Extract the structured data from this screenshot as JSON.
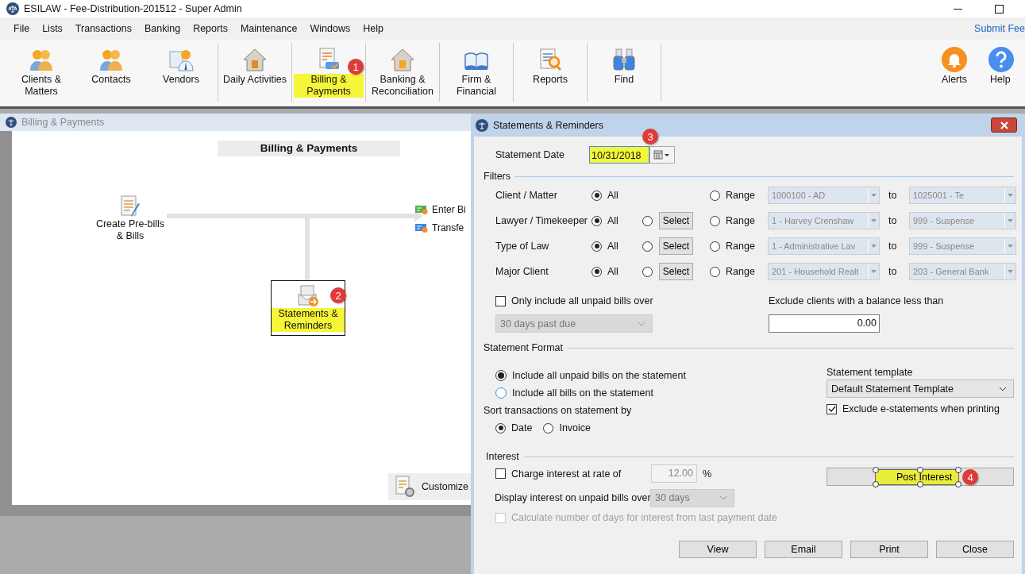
{
  "window": {
    "title": "ESILAW - Fee-Distribution-201512 - Super Admin"
  },
  "menu": [
    "File",
    "Lists",
    "Transactions",
    "Banking",
    "Reports",
    "Maintenance",
    "Windows",
    "Help"
  ],
  "feedback_link": "Submit Fee",
  "toolbar": {
    "groups": [
      [
        {
          "label": "Clients & Matters",
          "highlighted": false
        },
        {
          "label": "Contacts",
          "highlighted": false
        },
        {
          "label": "Vendors",
          "highlighted": false
        }
      ],
      [
        {
          "label": "Daily Activities",
          "highlighted": false
        }
      ],
      [
        {
          "label": "Billing & Payments",
          "highlighted": true,
          "badge": "1"
        }
      ],
      [
        {
          "label": "Banking & Reconciliation",
          "highlighted": false
        }
      ],
      [
        {
          "label": "Firm & Financial",
          "highlighted": false
        }
      ],
      [
        {
          "label": "Reports",
          "highlighted": false
        }
      ],
      [
        {
          "label": "Find",
          "highlighted": false
        }
      ]
    ],
    "right": [
      {
        "label": "Alerts"
      },
      {
        "label": "Help"
      }
    ]
  },
  "child_window": {
    "title": "Billing & Payments",
    "heading": "Billing & Payments",
    "nodes": [
      {
        "label": "Create Pre-bills & Bills",
        "selected": false,
        "highlighted": false
      },
      {
        "label": "Statements & Reminders",
        "selected": true,
        "highlighted": true,
        "badge": "2"
      }
    ],
    "links": [
      "Enter Bi",
      "Transfe"
    ],
    "customize": "Customize"
  },
  "dialog": {
    "title": "Statements & Reminders",
    "statement_date": {
      "label": "Statement Date",
      "value": "10/31/2018",
      "highlighted": true,
      "badge": "3"
    },
    "filters": {
      "title": "Filters",
      "rows": [
        {
          "label": "Client / Matter",
          "options": [
            {
              "kind": "radio",
              "label": "All",
              "selected": true
            },
            {
              "kind": "radio",
              "label": "Range",
              "selected": false
            }
          ],
          "from": {
            "value": "1000100 - AD",
            "disabled": true
          },
          "to_label": "to",
          "to": {
            "value": "1025001 - Te",
            "disabled": true
          }
        },
        {
          "label": "Lawyer / Timekeeper",
          "options": [
            {
              "kind": "radio",
              "label": "All",
              "selected": true
            },
            {
              "kind": "select",
              "label": "Select",
              "selected": false
            },
            {
              "kind": "radio",
              "label": "Range",
              "selected": false
            }
          ],
          "from": {
            "value": "1 - Harvey Crenshaw",
            "disabled": true
          },
          "to_label": "to",
          "to": {
            "value": "999 - Suspense",
            "disabled": true
          }
        },
        {
          "label": "Type of Law",
          "options": [
            {
              "kind": "radio",
              "label": "All",
              "selected": true
            },
            {
              "kind": "select",
              "label": "Select",
              "selected": false
            },
            {
              "kind": "radio",
              "label": "Range",
              "selected": false
            }
          ],
          "from": {
            "value": "1 - Administrative Lav",
            "disabled": true
          },
          "to_label": "to",
          "to": {
            "value": "999 - Suspense",
            "disabled": true
          }
        },
        {
          "label": "Major Client",
          "options": [
            {
              "kind": "radio",
              "label": "All",
              "selected": true
            },
            {
              "kind": "select",
              "label": "Select",
              "selected": false
            },
            {
              "kind": "radio",
              "label": "Range",
              "selected": false
            }
          ],
          "from": {
            "value": "201 - Household Realt",
            "disabled": true
          },
          "to_label": "to",
          "to": {
            "value": "203 - General Bank",
            "disabled": true
          }
        }
      ],
      "unpaid": {
        "label": "Only include all unpaid bills over",
        "checked": false,
        "dropdown": {
          "value": "30 days past due",
          "disabled": true
        }
      },
      "exclude": {
        "label": "Exclude clients with a balance less than",
        "value": "0.00"
      }
    },
    "format": {
      "title": "Statement Format",
      "include": [
        {
          "label": "Include all unpaid bills on the statement",
          "selected": true
        },
        {
          "label": "Include all bills on the statement",
          "selected": false
        }
      ],
      "sort_label": "Sort transactions on statement by",
      "sort": [
        {
          "label": "Date",
          "selected": true
        },
        {
          "label": "Invoice",
          "selected": false
        }
      ],
      "template_label": "Statement template",
      "template": {
        "value": "Default Statement Template",
        "disabled": false
      },
      "exclude_e": {
        "label": "Exclude e-statements when printing",
        "checked": true,
        "disabled": false
      }
    },
    "interest": {
      "title": "Interest",
      "charge": {
        "label": "Charge interest at rate of",
        "checked": false,
        "disabled": false
      },
      "rate": "12.00",
      "unit": "%",
      "display_label": "Display interest on unpaid bills over",
      "display": {
        "value": "30 days",
        "disabled": true
      },
      "calc": {
        "label": "Calculate number of days for interest from last payment date",
        "checked": false,
        "disabled": true
      },
      "post": {
        "label": "Post Interest",
        "highlighted": true,
        "badge": "4"
      }
    },
    "buttons": [
      "View",
      "Email",
      "Print",
      "Close"
    ]
  }
}
